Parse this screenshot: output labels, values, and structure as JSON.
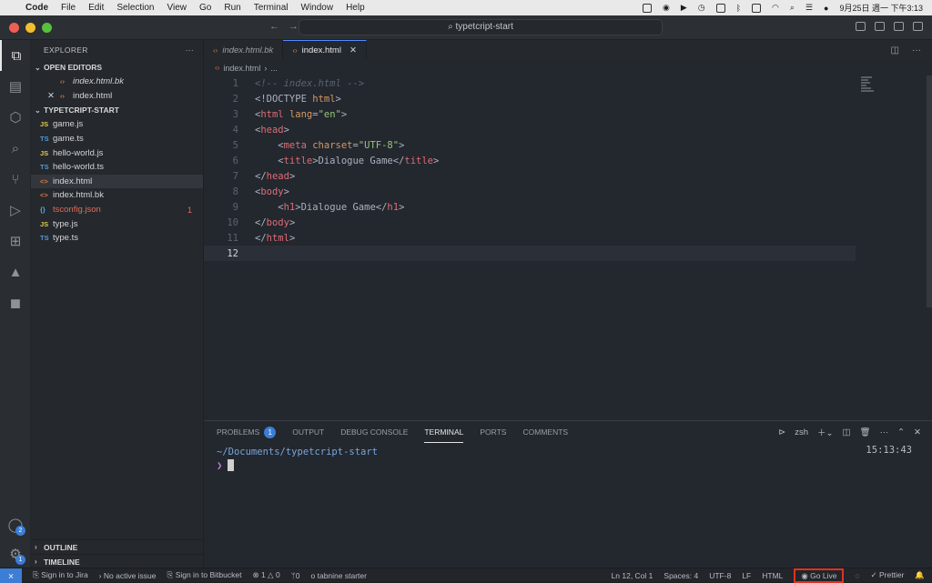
{
  "menubar": {
    "apple": "",
    "items": [
      "Code",
      "File",
      "Edit",
      "Selection",
      "View",
      "Go",
      "Run",
      "Terminal",
      "Window",
      "Help"
    ],
    "clock": "9月25日 週一 下午3:13"
  },
  "titlebar": {
    "search": "typetcript-start"
  },
  "activity": {
    "accounts_badge": "2",
    "settings_badge": "1"
  },
  "explorer": {
    "title": "EXPLORER",
    "open_editors_label": "OPEN EDITORS",
    "open_editors": [
      {
        "name": "index.html.bk"
      },
      {
        "name": "index.html"
      }
    ],
    "project_label": "TYPETCRIPT-START",
    "files": [
      {
        "icon": "JS",
        "name": "game.js",
        "type": "js"
      },
      {
        "icon": "TS",
        "name": "game.ts",
        "type": "ts"
      },
      {
        "icon": "JS",
        "name": "hello-world.js",
        "type": "js"
      },
      {
        "icon": "TS",
        "name": "hello-world.ts",
        "type": "ts"
      },
      {
        "icon": "<>",
        "name": "index.html",
        "type": "htm"
      },
      {
        "icon": "<>",
        "name": "index.html.bk",
        "type": "htm"
      },
      {
        "icon": "{}",
        "name": "tsconfig.json",
        "type": "json",
        "errors": "1"
      },
      {
        "icon": "JS",
        "name": "type.js",
        "type": "js"
      },
      {
        "icon": "TS",
        "name": "type.ts",
        "type": "ts"
      }
    ],
    "outline_label": "OUTLINE",
    "timeline_label": "TIMELINE"
  },
  "editor": {
    "tabs": [
      {
        "label": "index.html.bk"
      },
      {
        "label": "index.html"
      }
    ],
    "breadcrumb": "index.html",
    "breadcrumb_more": "...",
    "lines": [
      "1",
      "2",
      "3",
      "4",
      "5",
      "6",
      "7",
      "8",
      "9",
      "10",
      "11",
      "12"
    ],
    "code": {
      "l1": "<!-- index.html -->",
      "l2a": "<!DOCTYPE",
      "l2b": " html",
      "l2c": ">",
      "l3a": "<",
      "l3b": "html",
      "l3c": " lang",
      "l3d": "=",
      "l3e": "\"en\"",
      "l3f": ">",
      "l4a": "<",
      "l4b": "head",
      "l4c": ">",
      "l5a": "    <",
      "l5b": "meta",
      "l5c": " charset",
      "l5d": "=",
      "l5e": "\"UTF-8\"",
      "l5f": ">",
      "l6a": "    <",
      "l6b": "title",
      "l6c": ">Dialogue Game</",
      "l6d": "title",
      "l6e": ">",
      "l7a": "</",
      "l7b": "head",
      "l7c": ">",
      "l8a": "<",
      "l8b": "body",
      "l8c": ">",
      "l9a": "    <",
      "l9b": "h1",
      "l9c": ">Dialogue Game</",
      "l9d": "h1",
      "l9e": ">",
      "l10a": "</",
      "l10b": "body",
      "l10c": ">",
      "l11a": "</",
      "l11b": "html",
      "l11c": ">"
    }
  },
  "panel": {
    "tabs": [
      "PROBLEMS",
      "OUTPUT",
      "DEBUG CONSOLE",
      "TERMINAL",
      "PORTS",
      "COMMENTS"
    ],
    "problems_count": "1",
    "shell": "zsh",
    "terminal_path": "~/Documents/typetcript-start",
    "terminal_time": "15:13:43",
    "prompt": "❯"
  },
  "status": {
    "jira": "Sign in to Jira",
    "issue": "No active issue",
    "bitbucket": "Sign in to Bitbucket",
    "errors": "1",
    "warnings": "0",
    "ports": "0",
    "tabnine": "tabnine starter",
    "position": "Ln 12, Col 1",
    "spaces": "Spaces: 4",
    "encoding": "UTF-8",
    "eol": "LF",
    "language": "HTML",
    "golive": "Go Live",
    "prettier": "Prettier"
  }
}
